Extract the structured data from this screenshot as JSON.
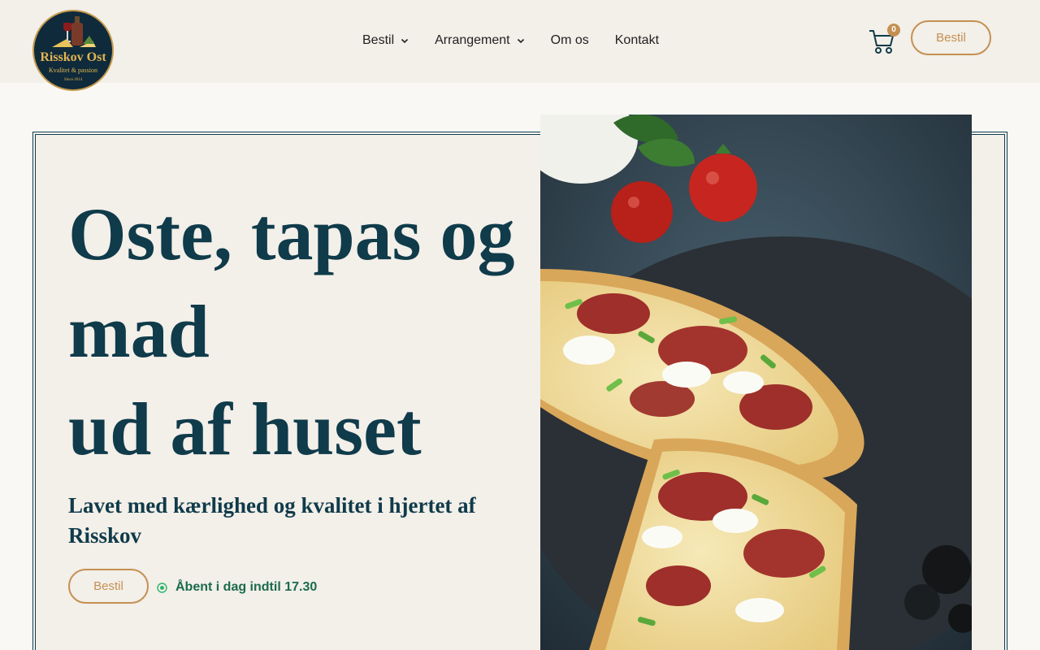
{
  "brand": {
    "name": "Risskov Ost",
    "tagline": "Kvalitet & passion",
    "since": "Since 2014"
  },
  "nav": {
    "items": [
      {
        "label": "Bestil",
        "has_dropdown": true
      },
      {
        "label": "Arrangement",
        "has_dropdown": true
      },
      {
        "label": "Om os",
        "has_dropdown": false
      },
      {
        "label": "Kontakt",
        "has_dropdown": false
      }
    ]
  },
  "header": {
    "cart_count": "0",
    "cta_label": "Bestil"
  },
  "hero": {
    "title_lines": [
      "Oste, tapas og",
      "mad",
      "ud af huset"
    ],
    "subtitle": "Lavet med kærlighed og kvalitet i hjertet af Risskov",
    "cta_label": "Bestil",
    "status_text": "Åbent i dag indtil 17.30"
  },
  "colors": {
    "primary": "#0f3b4a",
    "accent": "#c49052",
    "background": "#faf8f5",
    "panel": "#f3efe9",
    "status_open": "#1a6b4e"
  },
  "icons": {
    "cart": "cart-icon",
    "chevron": "chevron-down-icon",
    "status": "open-status-icon"
  }
}
